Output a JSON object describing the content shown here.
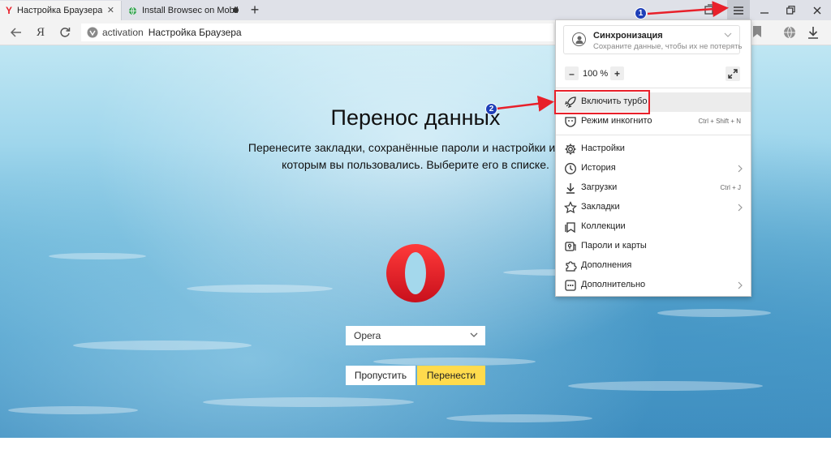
{
  "tabs": [
    {
      "title": "Настройка Браузера",
      "close_glyph": "✕",
      "favicon": "yandex-favicon"
    },
    {
      "title": "Install Browsec on Mobil",
      "favicon": "globe-favicon"
    }
  ],
  "new_tab_glyph": "+",
  "window_controls": [
    "minimize-icon",
    "restore-icon",
    "close-icon"
  ],
  "toolbar": {
    "yandex_glyph": "Я"
  },
  "address": {
    "domain": "activation",
    "title": "Настройка Браузера"
  },
  "page": {
    "heading": "Перенос данных",
    "description_line1": "Перенесите закладки, сохранённые пароли и настройки из бра",
    "description_line2": "которым вы пользовались. Выберите его в списке.",
    "selected_browser": "Opera",
    "skip_label": "Пропустить",
    "transfer_label": "Перенести"
  },
  "menu": {
    "sync_title": "Синхронизация",
    "sync_subtitle": "Сохраните данные, чтобы их не потерять",
    "zoom_minus": "–",
    "zoom_value": "100 %",
    "zoom_plus": "+",
    "items": [
      {
        "label": "Включить турбо",
        "icon": "rocket-icon"
      },
      {
        "label": "Режим инкогнито",
        "shortcut": "Ctrl + Shift + N",
        "icon": "mask-icon"
      },
      {
        "label": "Настройки",
        "icon": "gear-icon"
      },
      {
        "label": "История",
        "icon": "clock-icon",
        "submenu": true
      },
      {
        "label": "Загрузки",
        "shortcut": "Ctrl + J",
        "icon": "download-icon"
      },
      {
        "label": "Закладки",
        "icon": "star-icon",
        "submenu": true
      },
      {
        "label": "Коллекции",
        "icon": "collections-icon"
      },
      {
        "label": "Пароли и карты",
        "icon": "key-icon"
      },
      {
        "label": "Дополнения",
        "icon": "puzzle-icon"
      },
      {
        "label": "Дополнительно",
        "icon": "more-icon",
        "submenu": true
      }
    ]
  },
  "annotations": {
    "badge1": "1",
    "badge2": "2",
    "color": "#e8202a",
    "badge_color": "#1f3fb8"
  },
  "colors": {
    "transfer_button": "#ffdb4d",
    "opera_red": "#e0202a"
  }
}
